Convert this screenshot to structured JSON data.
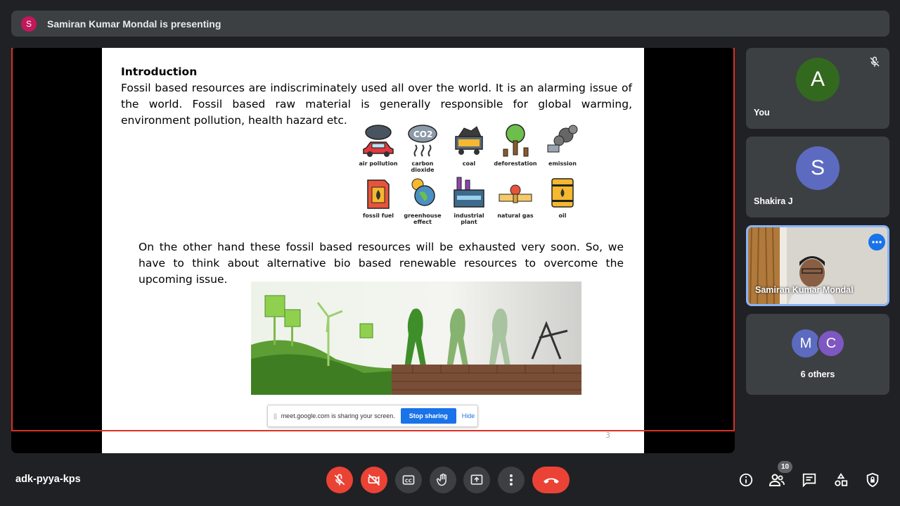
{
  "banner": {
    "avatar_letter": "S",
    "text": "Samiran Kumar Mondal is presenting"
  },
  "slide": {
    "heading": "Introduction",
    "paragraph1": "Fossil based resources are indiscriminately used all over the world. It is an alarming issue of the world. Fossil based raw material is generally responsible for global warming, environment pollution, health hazard etc.",
    "paragraph2": "On the other hand these fossil based resources will be exhausted very soon. So, we have to think about alternative bio based renewable resources to overcome the upcoming issue.",
    "page_number": "3",
    "icons": [
      {
        "label": "air pollution",
        "icon": "air-pollution-icon"
      },
      {
        "label": "carbon dioxide",
        "icon": "carbon-dioxide-icon"
      },
      {
        "label": "coal",
        "icon": "coal-icon"
      },
      {
        "label": "deforestation",
        "icon": "deforestation-icon"
      },
      {
        "label": "emission",
        "icon": "emission-icon"
      },
      {
        "label": "fossil fuel",
        "icon": "fossil-fuel-icon"
      },
      {
        "label": "greenhouse effect",
        "icon": "greenhouse-effect-icon"
      },
      {
        "label": "industrial plant",
        "icon": "industrial-plant-icon"
      },
      {
        "label": "natural gas",
        "icon": "natural-gas-icon"
      },
      {
        "label": "oil",
        "icon": "oil-icon"
      }
    ]
  },
  "share_bar": {
    "message": "meet.google.com is sharing your screen.",
    "stop_label": "Stop sharing",
    "hide_label": "Hide"
  },
  "participants": [
    {
      "name": "You",
      "letter": "A",
      "color": "#33691e",
      "muted": true
    },
    {
      "name": "Shakira J",
      "letter": "S",
      "color": "#5c6bc0"
    },
    {
      "name": "Samiran Kumar Mondal",
      "video": true
    },
    {
      "name": "6 others",
      "letters": [
        "M",
        "C"
      ],
      "colors": [
        "#5c6bc0",
        "#7e57c2"
      ]
    }
  ],
  "toolbar": {
    "meeting_code": "adk-pyya-kps",
    "participant_count": "10"
  },
  "colors": {
    "accent": "#1a73e8",
    "danger": "#ea4335",
    "background": "#202124",
    "tile": "#3c4043"
  }
}
